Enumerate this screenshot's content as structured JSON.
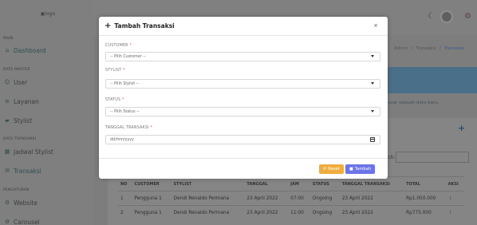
{
  "app": {
    "logo_alt": "logo"
  },
  "sidebar": {
    "sections": [
      {
        "label": "MAIN"
      },
      {
        "label": "DATA MASTER"
      },
      {
        "label": "DATA TRANSAKSI"
      },
      {
        "label": "PENGATURAN"
      }
    ],
    "items": [
      {
        "label": "Dashboard",
        "icon": "home-icon"
      },
      {
        "label": "User",
        "icon": "users-icon"
      },
      {
        "label": "Layanan",
        "icon": "list-icon"
      },
      {
        "label": "Stylist",
        "icon": "car-icon"
      },
      {
        "label": "Jadwal Stylist",
        "icon": "calendar-icon"
      },
      {
        "label": "Transaksi",
        "icon": "envelope-icon"
      },
      {
        "label": "Website",
        "icon": "gears-icon"
      },
      {
        "label": "Carousel",
        "icon": "gears-icon"
      }
    ]
  },
  "breadcrumb": [
    "Admin",
    "/",
    "Transaksi",
    "/",
    "Transaksi"
  ],
  "info_text": "vuar sebuah data baru.",
  "search_label": "rch:",
  "table": {
    "headers": [
      "NO",
      "CUSTOMER",
      "STYLIST",
      "TANGGAL",
      "JAM",
      "STATUS",
      "TANGGAL TRANSAKSI",
      "TOTAL",
      "AKSI"
    ],
    "rows": [
      [
        "1",
        "Pengguna 1",
        "Dendi Renaldo Permana",
        "23 April 2022",
        "07:00",
        "Ongoing",
        "23 April 2022",
        "Rp1.050.000",
        "⋮"
      ],
      [
        "2",
        "Pengguna 1",
        "Dendi Renaldo Permana",
        "23 April 2022",
        "11:00",
        "Ongoing",
        "23 April 2022",
        "Rp775.000",
        "⋮"
      ]
    ]
  },
  "modal": {
    "title": "Tambah Transaksi",
    "close": "×",
    "fields": {
      "customer": {
        "label": "CUSTOMER",
        "value": "-- Pilih Customer --"
      },
      "stylist": {
        "label": "STYLIST",
        "value": "-- Pilih Stylist --"
      },
      "status": {
        "label": "STATUS",
        "value": "-- Pilih Status --"
      },
      "tanggal": {
        "label": "TANGGAL TRANSAKSI",
        "placeholder": "dd/mm/yyyy"
      }
    },
    "required_mark": "*",
    "buttons": {
      "reset": "Reset",
      "add": "Tambah"
    }
  },
  "colors": {
    "reset_button": "#f0ad3e",
    "add_button": "#6b74e8",
    "required": "#d9534f"
  }
}
